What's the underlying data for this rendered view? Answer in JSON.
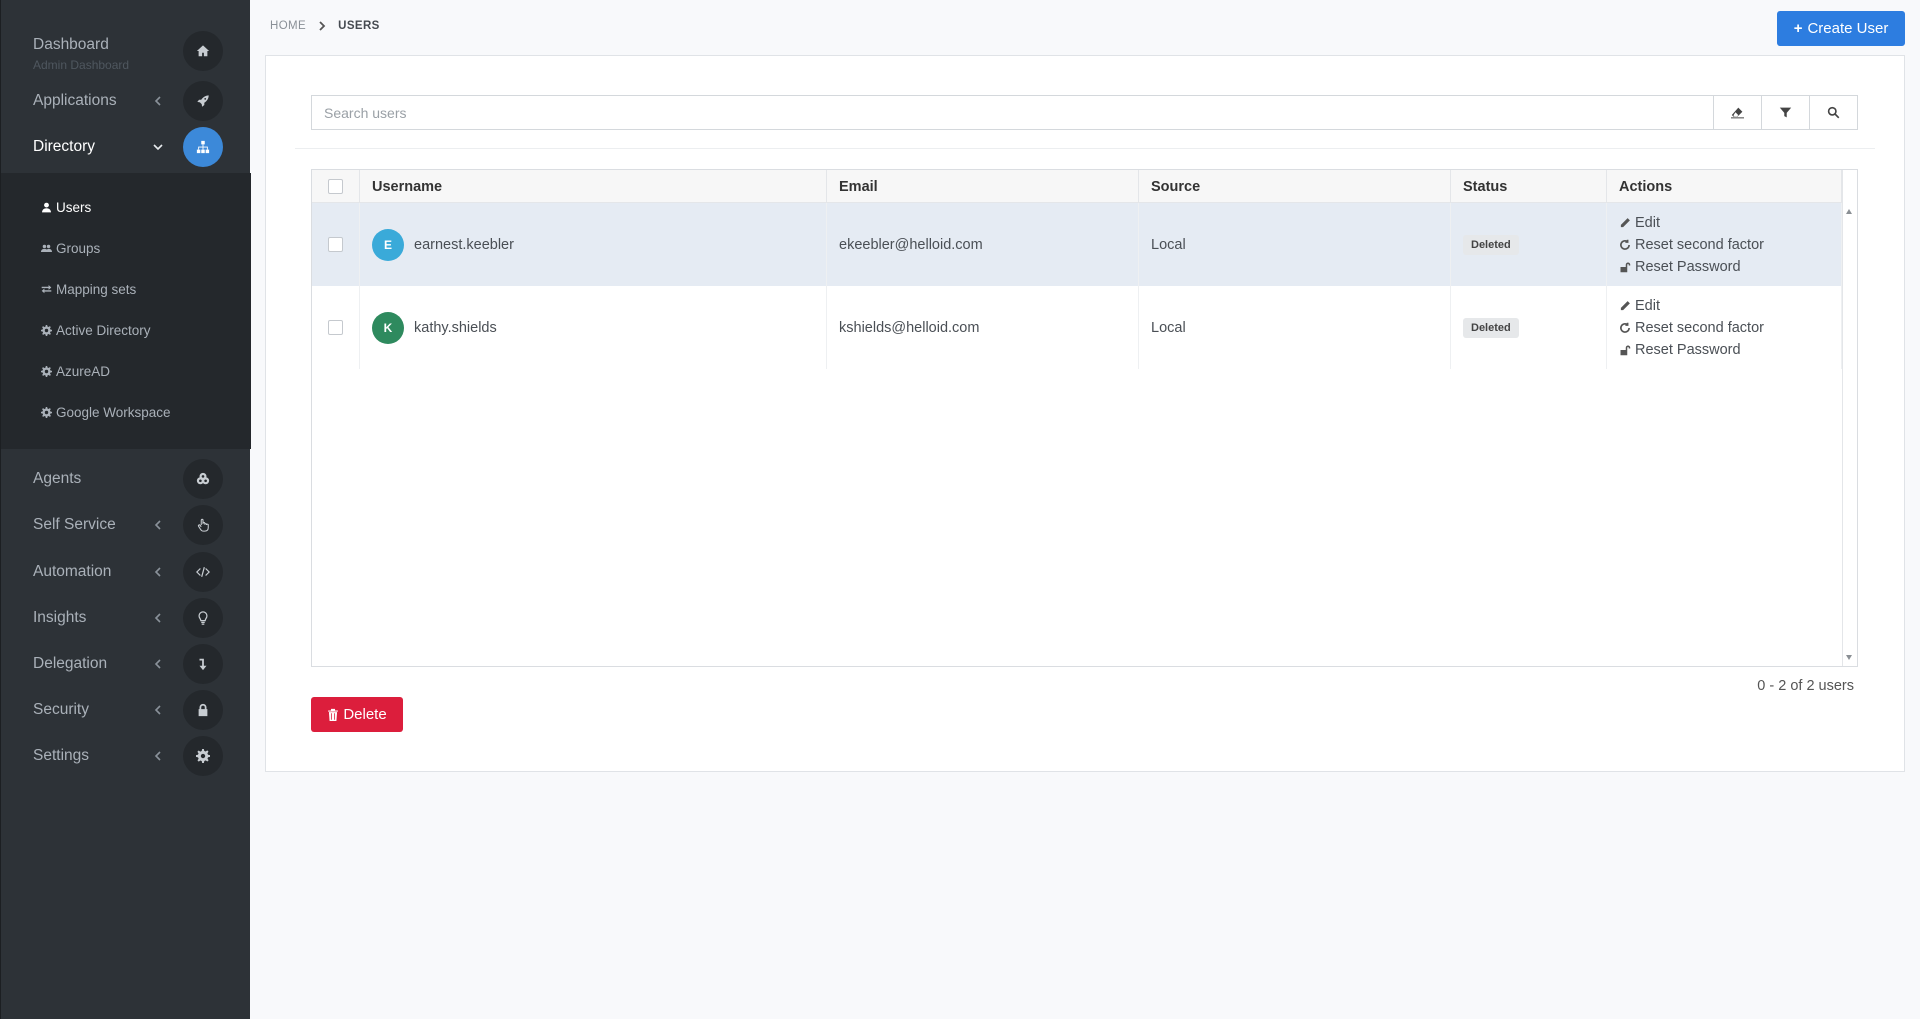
{
  "sidebar": {
    "dashboard": {
      "label": "Dashboard",
      "sub": "Admin Dashboard",
      "icon": "home-icon"
    },
    "applications": {
      "label": "Applications",
      "icon": "rocket-icon"
    },
    "directory": {
      "label": "Directory",
      "icon": "sitemap-icon"
    },
    "directory_items": [
      {
        "label": "Users",
        "icon": "user-icon"
      },
      {
        "label": "Groups",
        "icon": "users-icon"
      },
      {
        "label": "Mapping sets",
        "icon": "exchange-icon"
      },
      {
        "label": "Active Directory",
        "icon": "cog-icon"
      },
      {
        "label": "AzureAD",
        "icon": "cog-icon"
      },
      {
        "label": "Google Workspace",
        "icon": "cog-icon"
      }
    ],
    "agents": {
      "label": "Agents",
      "icon": "cogs-icon"
    },
    "self_service": {
      "label": "Self Service",
      "icon": "hand-pointer-icon"
    },
    "automation": {
      "label": "Automation",
      "icon": "code-icon"
    },
    "insights": {
      "label": "Insights",
      "icon": "lightbulb-icon"
    },
    "delegation": {
      "label": "Delegation",
      "icon": "level-down-icon"
    },
    "security": {
      "label": "Security",
      "icon": "lock-icon"
    },
    "settings": {
      "label": "Settings",
      "icon": "gear-icon"
    }
  },
  "breadcrumb": {
    "home": "HOME",
    "current": "USERS"
  },
  "create_button": "Create User",
  "search": {
    "placeholder": "Search users"
  },
  "table": {
    "columns": [
      "Username",
      "Email",
      "Source",
      "Status",
      "Actions"
    ],
    "rows": [
      {
        "initial": "E",
        "avatar_color": "#3aaad9",
        "username": "earnest.keebler",
        "email": "ekeebler@helloid.com",
        "source": "Local",
        "status": "Deleted",
        "selected": true
      },
      {
        "initial": "K",
        "avatar_color": "#2e8a5e",
        "username": "kathy.shields",
        "email": "kshields@helloid.com",
        "source": "Local",
        "status": "Deleted",
        "selected": false
      }
    ],
    "actions": {
      "edit": "Edit",
      "reset_second_factor": "Reset second factor",
      "reset_password": "Reset Password"
    }
  },
  "pager": "0 - 2 of 2 users",
  "delete_button": "Delete",
  "colors": {
    "primary": "#2d7de0",
    "danger": "#dc1e3c",
    "sidebar_bg": "#2d3237",
    "subnav_bg": "#24282c",
    "active_icon": "#3c89d9",
    "selected_row": "#e5ebf3"
  }
}
